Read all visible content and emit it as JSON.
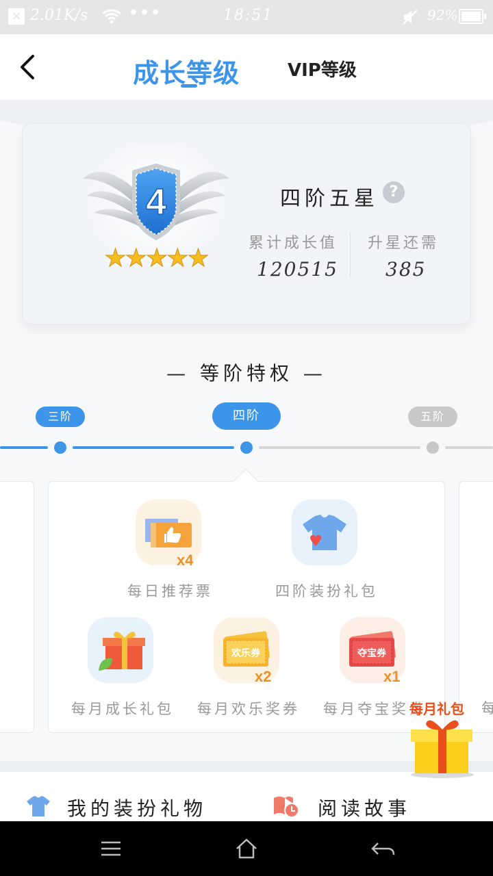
{
  "status_bar": {
    "speed": "2.01K/s",
    "dots": "•••",
    "time": "18:51",
    "battery": "92%"
  },
  "header": {
    "tab_growth": "成长等级",
    "tab_vip": "VIP等级"
  },
  "level_card": {
    "badge_number": "4",
    "stars": "★★★★★",
    "level_name": "四阶五星",
    "help": "?",
    "stats": [
      {
        "label": "累计成长值",
        "value": "120515"
      },
      {
        "label": "升星还需",
        "value": "385"
      }
    ]
  },
  "privileges": {
    "title": "— 等阶特权 —",
    "timeline": [
      {
        "label": "三阶",
        "state": "done"
      },
      {
        "label": "四阶",
        "state": "current"
      },
      {
        "label": "五阶",
        "state": "locked"
      }
    ],
    "benefits": [
      {
        "label": "每日推荐票",
        "icon": "ticket-thumbs-up-icon",
        "multiplier": "x4"
      },
      {
        "label": "四阶装扮礼包",
        "icon": "tshirt-heart-icon",
        "multiplier": ""
      },
      {
        "label": "每月成长礼包",
        "icon": "gift-leaf-icon",
        "multiplier": ""
      },
      {
        "label": "每月欢乐奖券",
        "icon": "joy-coupon-icon",
        "badge_text": "欢乐券",
        "multiplier": "x2"
      },
      {
        "label": "每月夺宝奖券",
        "icon": "treasure-coupon-icon",
        "badge_text": "夺宝券",
        "multiplier": "x1"
      }
    ],
    "next_panel_peek": "每"
  },
  "floating_gift": {
    "label": "每月礼包",
    "icon": "gift-box-icon"
  },
  "bottom_links": [
    {
      "label": "我的装扮礼物",
      "icon": "tshirt-icon"
    },
    {
      "label": "阅读故事",
      "icon": "book-clock-icon"
    }
  ],
  "colors": {
    "accent": "#3c95e8",
    "inactive": "#c8c8c8",
    "multiplier": "#e8932a",
    "gift_red": "#e94e1b"
  }
}
